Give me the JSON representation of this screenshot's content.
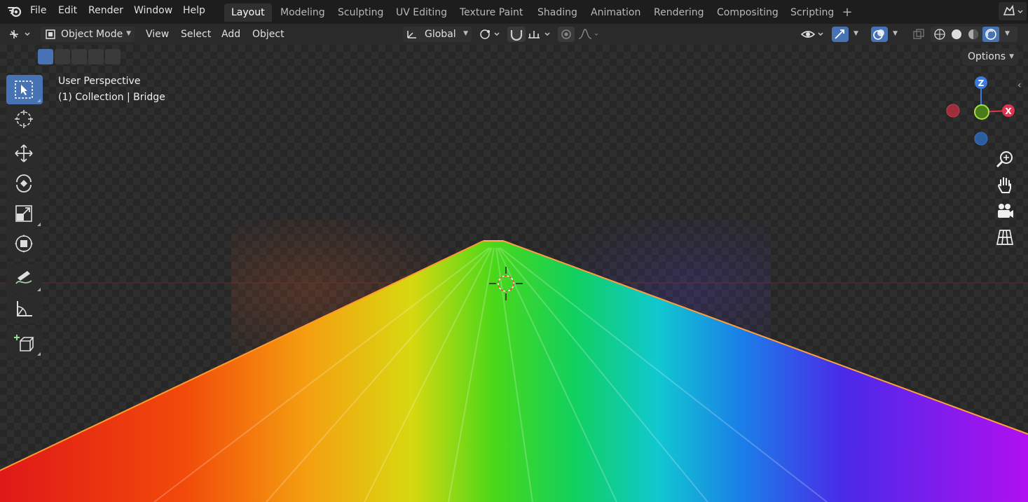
{
  "app": {
    "name": "Blender"
  },
  "menus": [
    "File",
    "Edit",
    "Render",
    "Window",
    "Help"
  ],
  "workspaces": [
    {
      "label": "Layout",
      "active": true
    },
    {
      "label": "Modeling",
      "active": false
    },
    {
      "label": "Sculpting",
      "active": false
    },
    {
      "label": "UV Editing",
      "active": false
    },
    {
      "label": "Texture Paint",
      "active": false
    },
    {
      "label": "Shading",
      "active": false
    },
    {
      "label": "Animation",
      "active": false
    },
    {
      "label": "Rendering",
      "active": false
    },
    {
      "label": "Compositing",
      "active": false
    },
    {
      "label": "Scripting",
      "active": false
    }
  ],
  "header": {
    "mode": "Object Mode",
    "menus": [
      "View",
      "Select",
      "Add",
      "Object"
    ],
    "transform_orientation": "Global",
    "options_label": "Options"
  },
  "viewport": {
    "view_name": "User Perspective",
    "collection_info": "(1) Collection | Bridge"
  },
  "gizmo": {
    "z_label": "Z",
    "x_label": "X"
  },
  "toolbar": [
    "select-box-tool",
    "cursor-tool",
    "move-tool",
    "rotate-tool",
    "scale-tool",
    "transform-tool",
    "annotate-tool",
    "measure-tool",
    "add-cube-tool"
  ],
  "colors": {
    "accent": "#4772b3",
    "bg": "#1d1d1d",
    "header": "#2a2a2a"
  }
}
